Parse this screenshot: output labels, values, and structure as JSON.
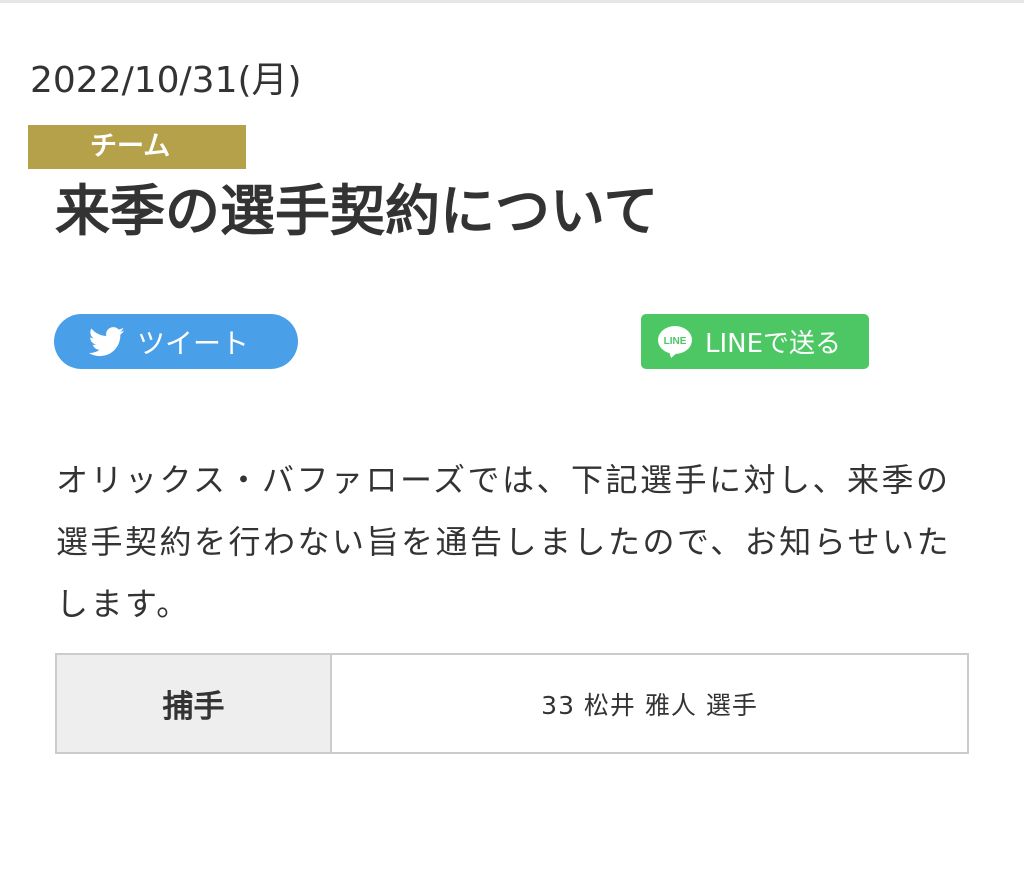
{
  "article": {
    "date": "2022/10/31(月)",
    "category": "チーム",
    "title": "来季の選手契約について",
    "body": "オリックス・バファローズでは、下記選手に対し、来季の選手契約を行わない旨を通告しましたので、お知らせいたします。"
  },
  "share": {
    "tweet_label": "ツイート",
    "tweet_icon": "twitter-bird-icon",
    "line_label": "LINEで送る",
    "line_icon_text": "LINE",
    "line_icon": "line-logo-icon"
  },
  "roster": [
    {
      "position": "捕手",
      "player": "33 松井 雅人 選手"
    }
  ],
  "colors": {
    "category_bg": "#b6a14b",
    "tweet_bg": "#4a9fe9",
    "line_bg": "#4cc764",
    "table_border": "#cccccc",
    "table_header_bg": "#eeeeee",
    "text": "#333333"
  }
}
